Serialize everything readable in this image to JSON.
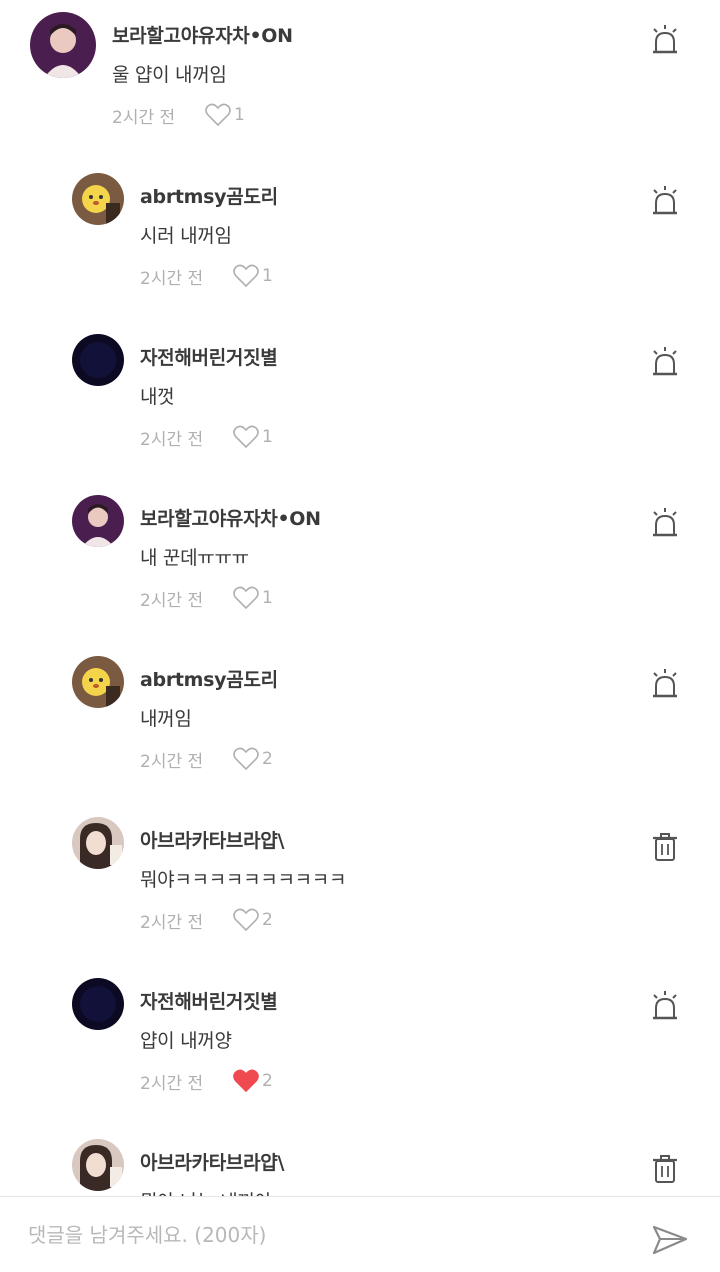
{
  "comments": [
    {
      "author": "보라할고야유자차•ON",
      "text": "울 얍이 내꺼임",
      "time": "2시간 전",
      "likes": "1",
      "liked": false,
      "action": "report-siren-icon",
      "avatar": "purple-portrait"
    },
    {
      "author": "abrtmsy곰도리",
      "text": "시러 내꺼임",
      "time": "2시간 전",
      "likes": "1",
      "liked": false,
      "action": "report-siren-icon",
      "avatar": "yellow-character"
    },
    {
      "author": "자전해버린거짓별",
      "text": "내껏",
      "time": "2시간 전",
      "likes": "1",
      "liked": false,
      "action": "report-siren-icon",
      "avatar": "dark"
    },
    {
      "author": "보라할고야유자차•ON",
      "text": "내 꾼데ㅠㅠㅠ",
      "time": "2시간 전",
      "likes": "1",
      "liked": false,
      "action": "report-siren-icon",
      "avatar": "purple-portrait"
    },
    {
      "author": "abrtmsy곰도리",
      "text": "내꺼임",
      "time": "2시간 전",
      "likes": "2",
      "liked": false,
      "action": "report-siren-icon",
      "avatar": "yellow-character"
    },
    {
      "author": "아브라카타브라얍\\",
      "text": "뭐야ㅋㅋㅋㅋㅋㅋㅋㅋㅋㅋ",
      "time": "2시간 전",
      "likes": "2",
      "liked": false,
      "action": "trash-icon",
      "avatar": "girl-portrait"
    },
    {
      "author": "자전해버린거짓별",
      "text": "얍이 내꺼양",
      "time": "2시간 전",
      "likes": "2",
      "liked": true,
      "action": "report-siren-icon",
      "avatar": "dark"
    },
    {
      "author": "아브라카타브라얍\\",
      "text": "뭐야 나는 내꺼야 ㅋㅋㅋ",
      "time": "",
      "likes": "",
      "liked": false,
      "action": "trash-icon",
      "avatar": "girl-portrait"
    }
  ],
  "input": {
    "placeholder": "댓글을 남겨주세요. (200자)",
    "value": "",
    "send_icon": "send-icon"
  },
  "colors": {
    "liked_heart": "#f0494f",
    "muted": "#b0b0b0",
    "icon": "#555555",
    "divider": "#e6e6e6"
  }
}
